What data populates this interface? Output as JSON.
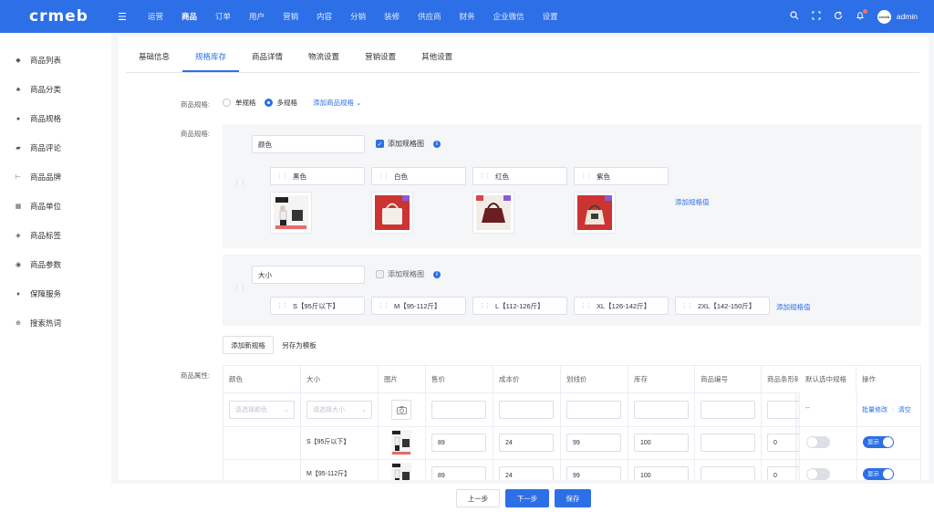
{
  "app": {
    "logo": "crmeb"
  },
  "nav": {
    "items": [
      {
        "label": "运营"
      },
      {
        "label": "商品",
        "active": true
      },
      {
        "label": "订单"
      },
      {
        "label": "用户"
      },
      {
        "label": "营销"
      },
      {
        "label": "内容"
      },
      {
        "label": "分销"
      },
      {
        "label": "装修"
      },
      {
        "label": "供应商"
      },
      {
        "label": "财务"
      },
      {
        "label": "企业微信"
      },
      {
        "label": "设置"
      }
    ],
    "user": "admin"
  },
  "sidebar": {
    "items": [
      {
        "label": "商品列表",
        "icon": "bag-icon"
      },
      {
        "label": "商品分类",
        "icon": "category-icon"
      },
      {
        "label": "商品规格",
        "icon": "cube-icon"
      },
      {
        "label": "商品评论",
        "icon": "comment-icon"
      },
      {
        "label": "商品品牌",
        "icon": "brand-icon"
      },
      {
        "label": "商品单位",
        "icon": "unit-icon"
      },
      {
        "label": "商品标签",
        "icon": "tag-icon"
      },
      {
        "label": "商品参数",
        "icon": "eye-icon"
      },
      {
        "label": "保障服务",
        "icon": "shield-icon"
      },
      {
        "label": "搜索热词",
        "icon": "globe-icon"
      }
    ]
  },
  "tabs": [
    {
      "label": "基础信息"
    },
    {
      "label": "规格库存",
      "active": true
    },
    {
      "label": "商品详情"
    },
    {
      "label": "物流设置"
    },
    {
      "label": "营销设置"
    },
    {
      "label": "其他设置"
    }
  ],
  "form": {
    "spec_type_label": "商品规格:",
    "single_spec": "单规格",
    "multi_spec": "多规格",
    "add_spec_link": "添加商品规格",
    "spec_label": "商品规格:",
    "attr_label": "商品属性:"
  },
  "specs": [
    {
      "name": "颜色",
      "add_image_label": "添加规格图",
      "image_checked": true,
      "values": [
        "黑色",
        "白色",
        "红色",
        "紫色"
      ],
      "add_value_link": "添加规格值"
    },
    {
      "name": "大小",
      "add_image_label": "添加规格图",
      "image_checked": false,
      "values": [
        "S【95斤以下】",
        "M【95-112斤】",
        "L【112-126斤】",
        "XL【126-142斤】",
        "2XL【142-150斤】"
      ],
      "add_value_link": "添加规格值"
    }
  ],
  "buttons": {
    "add_spec": "添加新规格",
    "save_template": "另存为模板",
    "prev": "上一步",
    "next": "下一步",
    "save": "保存"
  },
  "table": {
    "headers": [
      "颜色",
      "大小",
      "图片",
      "售价",
      "成本价",
      "划线价",
      "库存",
      "商品编号",
      "商品条形码",
      "默认选中规格",
      "操作"
    ],
    "filter": {
      "color_placeholder": "请选择颜色",
      "size_placeholder": "请选择大小",
      "default_dash": "--",
      "batch_edit": "批量修改",
      "clear": "清空"
    },
    "rows": [
      {
        "size": "S【95斤以下】",
        "price": "89",
        "cost": "24",
        "line_price": "99",
        "stock": "100",
        "barcode": "0",
        "default_on": false,
        "show_label": "显示"
      },
      {
        "size": "M【95-112斤】",
        "price": "89",
        "cost": "24",
        "line_price": "99",
        "stock": "100",
        "barcode": "0",
        "default_on": false,
        "show_label": "显示"
      }
    ]
  },
  "colors": {
    "primary": "#2d6fe6",
    "topbar": "#2d6fe6"
  }
}
